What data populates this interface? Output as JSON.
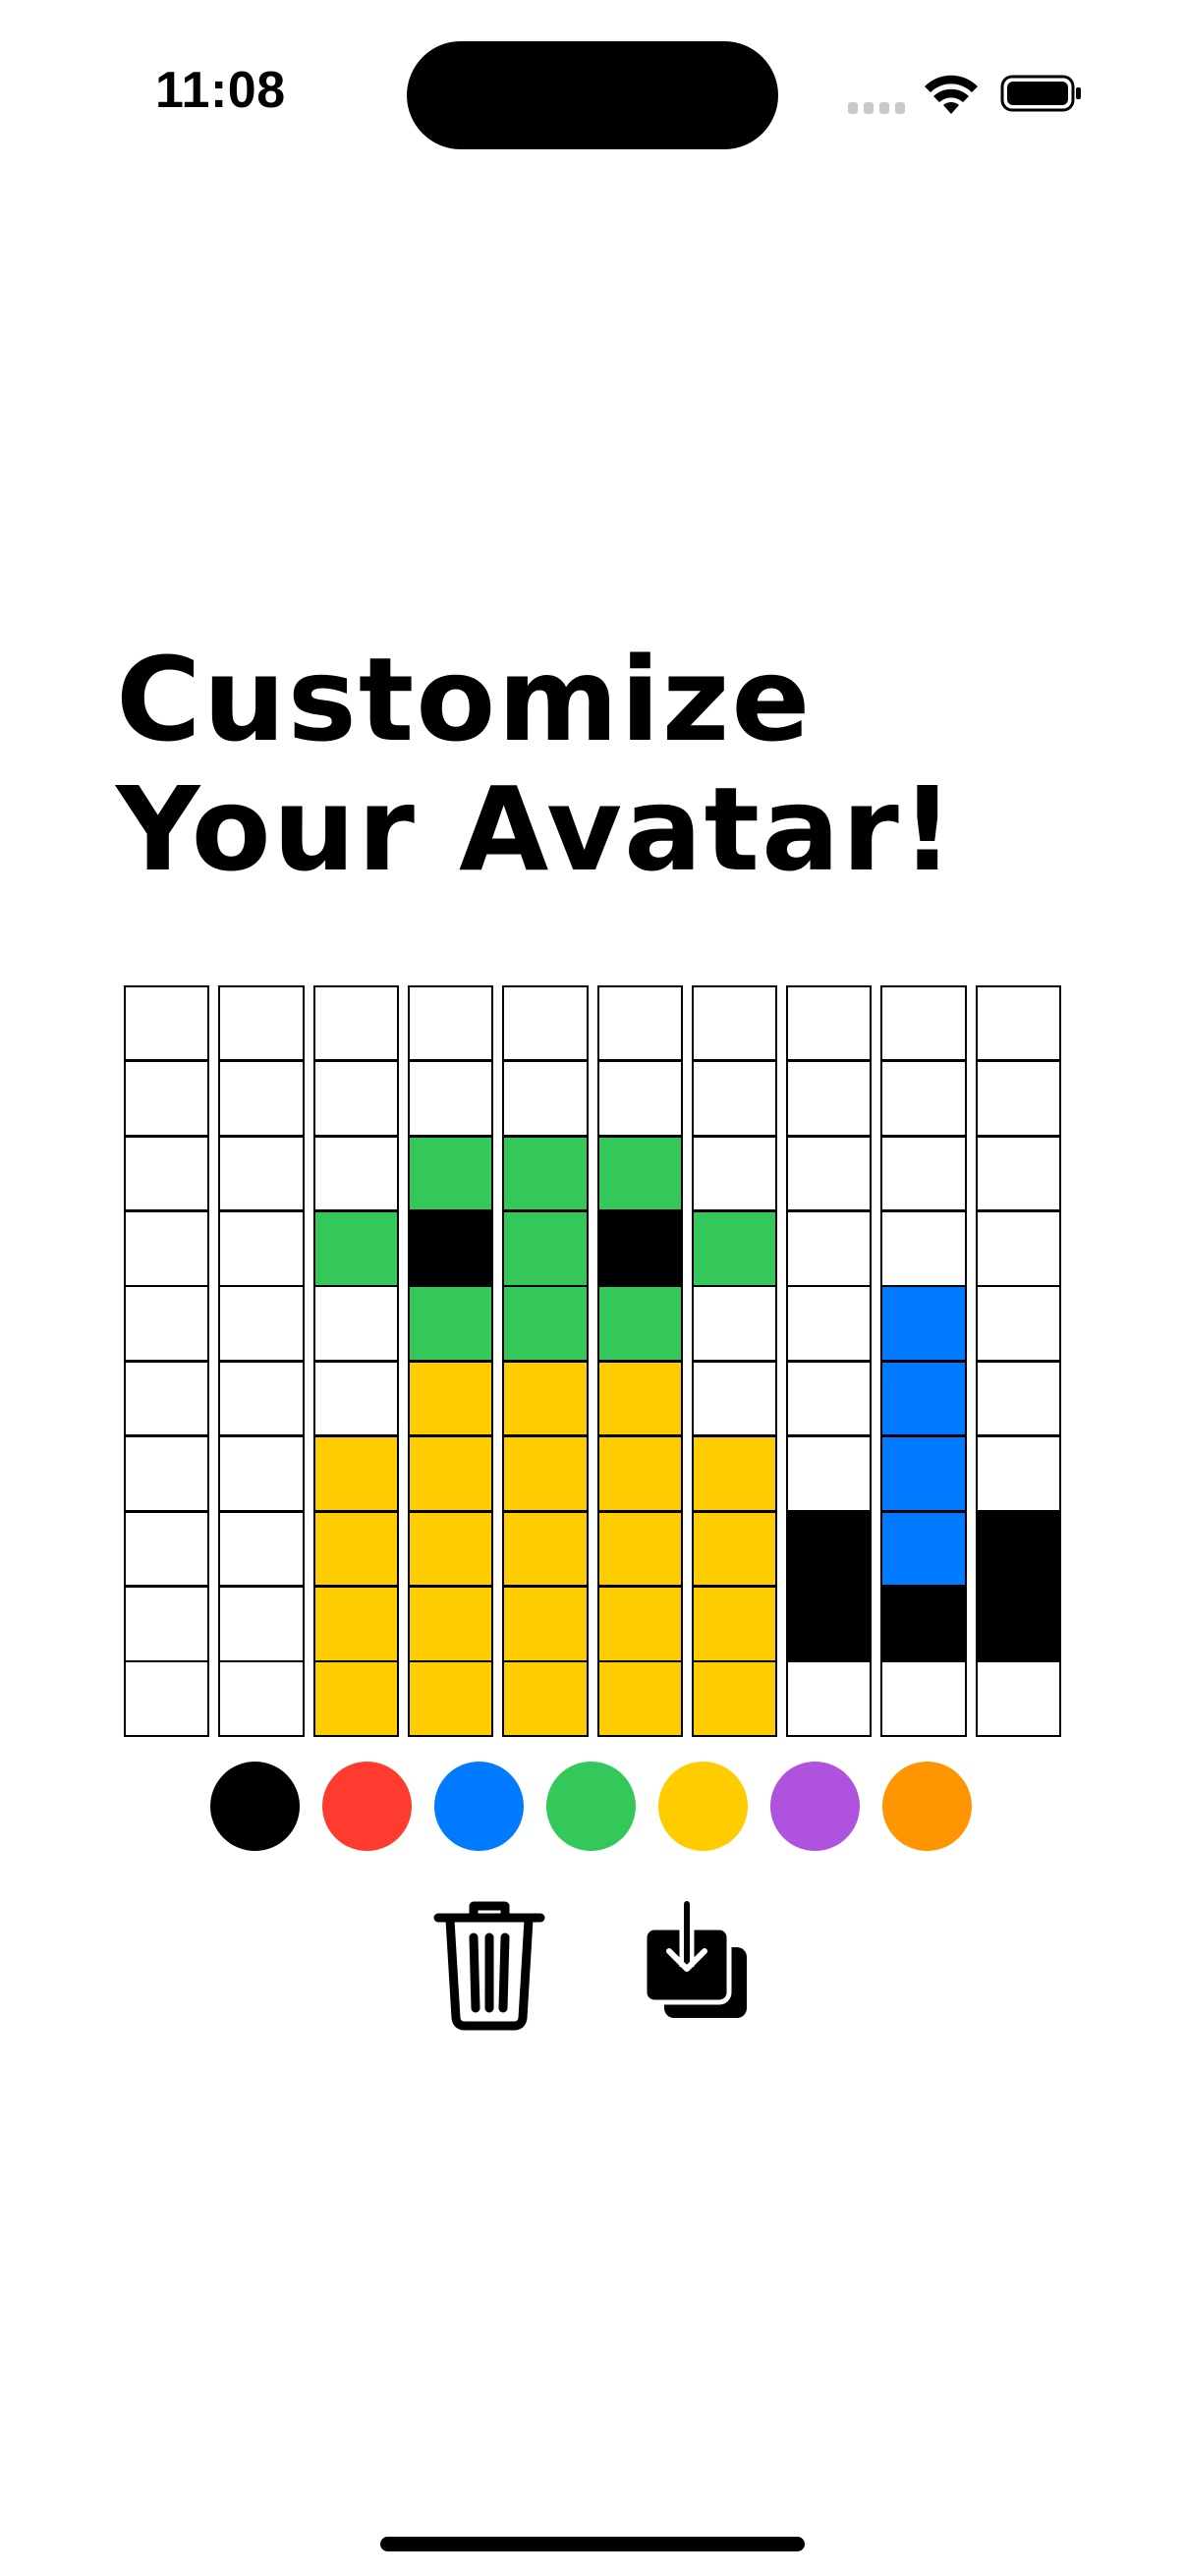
{
  "status_bar": {
    "time": "11:08"
  },
  "title": {
    "line1": "Customize",
    "line2": "Your Avatar!"
  },
  "colors": {
    "white": "#FFFFFF",
    "black": "#000000",
    "red": "#FF3B30",
    "blue": "#007AFF",
    "green": "#34C759",
    "yellow": "#FFCC00",
    "purple": "#AF52DE",
    "orange": "#FF9500"
  },
  "grid": {
    "rows": [
      [
        "white",
        "white",
        "white",
        "white",
        "white",
        "white",
        "white",
        "white",
        "white",
        "white"
      ],
      [
        "white",
        "white",
        "white",
        "white",
        "white",
        "white",
        "white",
        "white",
        "white",
        "white"
      ],
      [
        "white",
        "white",
        "white",
        "green",
        "green",
        "green",
        "white",
        "white",
        "white",
        "white"
      ],
      [
        "white",
        "white",
        "green",
        "black",
        "green",
        "black",
        "green",
        "white",
        "white",
        "white"
      ],
      [
        "white",
        "white",
        "white",
        "green",
        "green",
        "green",
        "white",
        "white",
        "blue",
        "white"
      ],
      [
        "white",
        "white",
        "white",
        "yellow",
        "yellow",
        "yellow",
        "white",
        "white",
        "blue",
        "white"
      ],
      [
        "white",
        "white",
        "yellow",
        "yellow",
        "yellow",
        "yellow",
        "yellow",
        "white",
        "blue",
        "white"
      ],
      [
        "white",
        "white",
        "yellow",
        "yellow",
        "yellow",
        "yellow",
        "yellow",
        "black",
        "blue",
        "black"
      ],
      [
        "white",
        "white",
        "yellow",
        "yellow",
        "yellow",
        "yellow",
        "yellow",
        "black",
        "black",
        "black"
      ],
      [
        "white",
        "white",
        "yellow",
        "yellow",
        "yellow",
        "yellow",
        "yellow",
        "white",
        "white",
        "white"
      ]
    ]
  },
  "palette": [
    "black",
    "red",
    "blue",
    "green",
    "yellow",
    "purple",
    "orange"
  ],
  "actions": {
    "clear_icon": "trash-icon",
    "save_icon": "save-to-photos-icon"
  }
}
